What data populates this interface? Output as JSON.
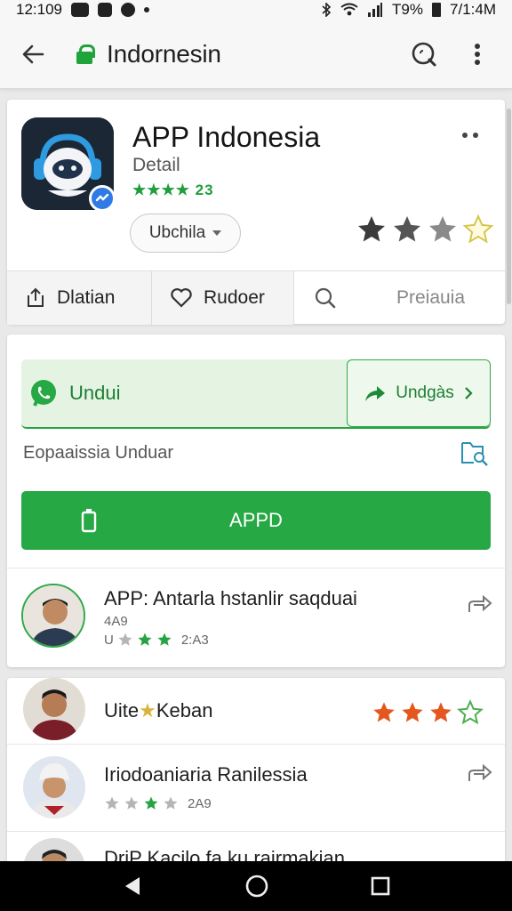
{
  "statusbar": {
    "time": "12:109",
    "battery_text": "T9%",
    "clock_right": "7/1:4M"
  },
  "appbar": {
    "title": "Indornesin"
  },
  "app": {
    "title": "APP Indonesia",
    "subtitle": "Detail",
    "rating_text": "★★★★ 23",
    "dropdown_label": "Ubchila",
    "rating_stars": 3
  },
  "tabs": [
    {
      "label": "Dlatian"
    },
    {
      "label": "Rudoer"
    },
    {
      "label": ""
    },
    {
      "label": "Preiauia"
    }
  ],
  "download": {
    "main_label": "Undui",
    "side_label": "Undgàs",
    "status_text": "Eopaaissia Unduar",
    "button_label": "APPD"
  },
  "list": [
    {
      "title": "APP: Antarla hstanlir saqduai",
      "meta": "4A9",
      "prefix": "U",
      "stars_text": "2:A3"
    },
    {
      "title": "Uite",
      "title_suffix": "Keban",
      "meta": "",
      "stars": 3
    },
    {
      "title": "Iriodoaniaria Ranilessia",
      "meta": "",
      "stars_text": "2A9"
    },
    {
      "title": "DriP Kacilo fa ku rairmakian",
      "meta": ""
    }
  ],
  "colors": {
    "accent_green": "#26a844",
    "star_dark": "#3b3b3b",
    "star_orange": "#e4571e"
  }
}
